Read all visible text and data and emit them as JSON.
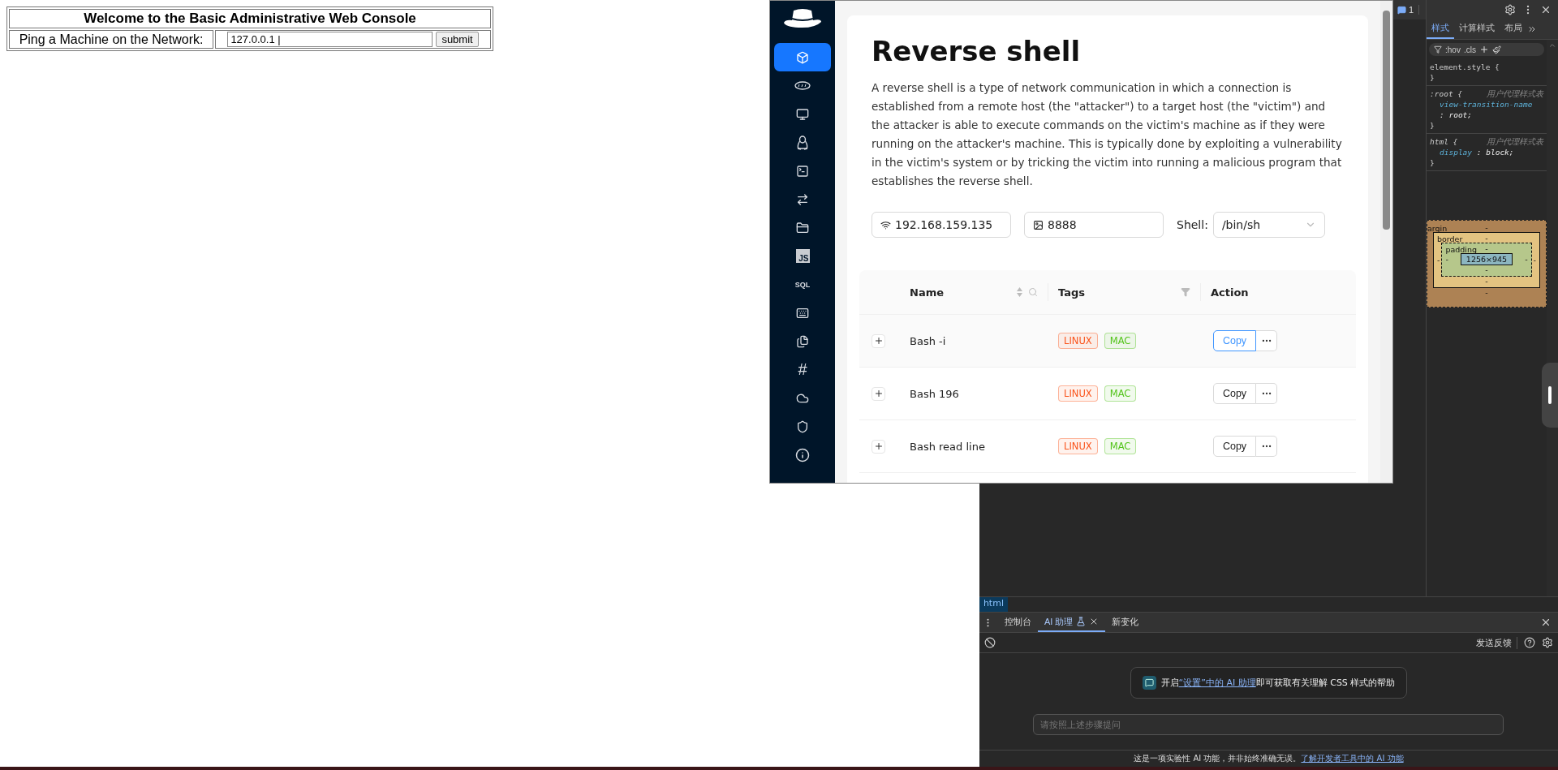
{
  "console": {
    "title": "Welcome to the Basic Administrative Web Console",
    "ping_label": "Ping a Machine on the Network:",
    "ping_value": "127.0.0.1 |",
    "submit_label": "submit"
  },
  "tool_window": {
    "sidebar": [
      {
        "kind": "cube",
        "selected": true
      },
      {
        "kind": "php",
        "selected": false
      },
      {
        "kind": "monitor",
        "selected": false
      },
      {
        "kind": "penguin",
        "selected": false
      },
      {
        "kind": "terminal",
        "selected": false
      },
      {
        "kind": "transfer",
        "selected": false
      },
      {
        "kind": "folder",
        "selected": false
      },
      {
        "kind": "badge",
        "label": "JS",
        "selected": false
      },
      {
        "kind": "text",
        "label": "SQL",
        "selected": false
      },
      {
        "kind": "keyboard",
        "selected": false
      },
      {
        "kind": "files",
        "selected": false
      },
      {
        "kind": "text",
        "label": "#",
        "selected": false
      },
      {
        "kind": "cloud",
        "selected": false
      },
      {
        "kind": "shield",
        "selected": false
      },
      {
        "kind": "info",
        "selected": false
      }
    ],
    "title": "Reverse shell",
    "description": "A reverse shell is a type of network communication in which a connection is established from a remote host (the \"attacker\") to a target host (the \"victim\") and the attacker is able to execute commands on the victim's machine as if they were running on the attacker's machine. This is typically done by exploiting a vulnerability in the victim's system or by tricking the victim into running a malicious program that establishes the reverse shell.",
    "ip_value": "192.168.159.135",
    "port_value": "8888",
    "shell_label": "Shell:",
    "shell_value": "/bin/sh",
    "columns": [
      {
        "label": "Name",
        "kind": "sortable"
      },
      {
        "label": "Tags",
        "kind": "filter"
      },
      {
        "label": "Action",
        "kind": "plain"
      }
    ],
    "rows": [
      {
        "name": "Bash -i",
        "hovered": true,
        "tags": [
          {
            "label": "LINUX",
            "color": "#fa541c"
          },
          {
            "label": "MAC",
            "color": "#52c41a"
          }
        ],
        "action": "Copy"
      },
      {
        "name": "Bash 196",
        "hovered": false,
        "tags": [
          {
            "label": "LINUX",
            "color": "#fa541c"
          },
          {
            "label": "MAC",
            "color": "#52c41a"
          }
        ],
        "action": "Copy"
      },
      {
        "name": "Bash read line",
        "hovered": false,
        "tags": [
          {
            "label": "LINUX",
            "color": "#fa541c"
          },
          {
            "label": "MAC",
            "color": "#52c41a"
          }
        ],
        "action": "Copy"
      }
    ]
  },
  "devtools": {
    "issues_count": "1",
    "styles_tabs": [
      {
        "label": "样式",
        "selected": true
      },
      {
        "label": "计算样式",
        "selected": false
      },
      {
        "label": "布局",
        "selected": false
      }
    ],
    "filter_toggles": [
      ":hov",
      ".cls"
    ],
    "rules": [
      {
        "selector": "element.style {",
        "close": "}"
      },
      {
        "selector": ":root {",
        "origin": "用户代理样式表",
        "declarations": [
          {
            "property": "view-transition-name",
            "value": ": root;"
          }
        ],
        "close": "}"
      },
      {
        "selector": "html {",
        "origin": "用户代理样式表",
        "declarations": [
          {
            "property": "display",
            "value": ": block;"
          }
        ],
        "close": "}"
      }
    ],
    "box_model": {
      "margin": {
        "label": "argin",
        "top": "-",
        "bottom": "-"
      },
      "border": {
        "label": "border",
        "top": "-",
        "bottom": "-",
        "left": "-",
        "right": "-"
      },
      "padding": {
        "label": "padding",
        "top": "-",
        "bottom": "-",
        "left": "-",
        "right": "-"
      },
      "content": "1256×945"
    },
    "breadcrumb": "html",
    "drawer_tabs": [
      {
        "label": "控制台",
        "selected": false,
        "closable": false,
        "experimental": false
      },
      {
        "label": "AI 助理",
        "selected": true,
        "closable": true,
        "experimental": true
      },
      {
        "label": "新变化",
        "selected": false,
        "closable": false,
        "experimental": false
      }
    ],
    "feedback": "发送反馈",
    "ai_notice": {
      "before": "开启",
      "link": "“设置”中的 AI 助理",
      "after": "即可获取有关理解 CSS 样式的帮助"
    },
    "prompt_placeholder": "请按照上述步骤提问",
    "footer": {
      "text": "这是一项实验性 AI 功能，并非始终准确无误。",
      "link": "了解开发者工具中的 AI 功能"
    }
  }
}
